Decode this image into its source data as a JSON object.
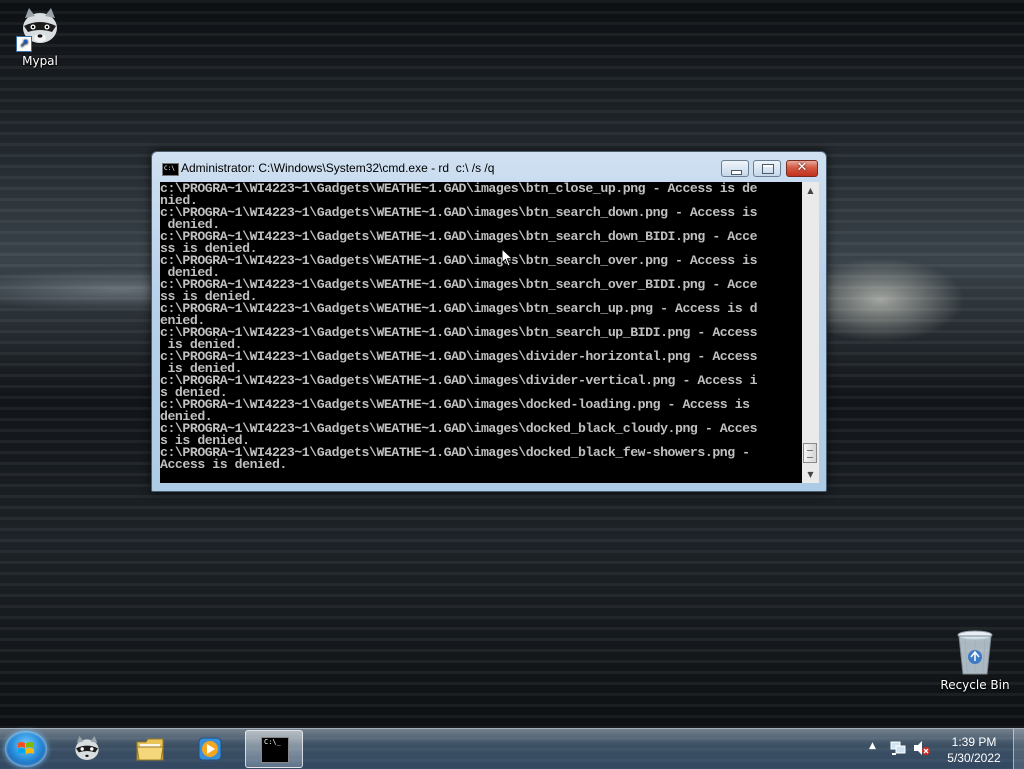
{
  "desktop": {
    "icons": [
      {
        "label": "Mypal",
        "icon": "raccoon-icon"
      },
      {
        "label": "Recycle Bin",
        "icon": "recycle-bin-icon"
      }
    ]
  },
  "cmd_window": {
    "icon_text": "C:\\",
    "title": "Administrator: C:\\Windows\\System32\\cmd.exe - rd  c:\\ /s /q",
    "minimize_glyph": "",
    "maximize_glyph": "",
    "close_glyph": "✕",
    "lines": [
      "c:\\PROGRA~1\\WI4223~1\\Gadgets\\WEATHE~1.GAD\\images\\btn_close_up.png - Access is de",
      "nied.",
      "c:\\PROGRA~1\\WI4223~1\\Gadgets\\WEATHE~1.GAD\\images\\btn_search_down.png - Access is",
      " denied.",
      "c:\\PROGRA~1\\WI4223~1\\Gadgets\\WEATHE~1.GAD\\images\\btn_search_down_BIDI.png - Acce",
      "ss is denied.",
      "c:\\PROGRA~1\\WI4223~1\\Gadgets\\WEATHE~1.GAD\\images\\btn_search_over.png - Access is",
      " denied.",
      "c:\\PROGRA~1\\WI4223~1\\Gadgets\\WEATHE~1.GAD\\images\\btn_search_over_BIDI.png - Acce",
      "ss is denied.",
      "c:\\PROGRA~1\\WI4223~1\\Gadgets\\WEATHE~1.GAD\\images\\btn_search_up.png - Access is d",
      "enied.",
      "c:\\PROGRA~1\\WI4223~1\\Gadgets\\WEATHE~1.GAD\\images\\btn_search_up_BIDI.png - Access",
      " is denied.",
      "c:\\PROGRA~1\\WI4223~1\\Gadgets\\WEATHE~1.GAD\\images\\divider-horizontal.png - Access",
      " is denied.",
      "c:\\PROGRA~1\\WI4223~1\\Gadgets\\WEATHE~1.GAD\\images\\divider-vertical.png - Access i",
      "s denied.",
      "c:\\PROGRA~1\\WI4223~1\\Gadgets\\WEATHE~1.GAD\\images\\docked-loading.png - Access is",
      "denied.",
      "c:\\PROGRA~1\\WI4223~1\\Gadgets\\WEATHE~1.GAD\\images\\docked_black_cloudy.png - Acces",
      "s is denied.",
      "c:\\PROGRA~1\\WI4223~1\\Gadgets\\WEATHE~1.GAD\\images\\docked_black_few-showers.png -",
      "Access is denied."
    ]
  },
  "taskbar": {
    "buttons": [
      {
        "name": "start",
        "icon": "windows-logo-icon"
      },
      {
        "name": "mypal",
        "icon": "raccoon-icon"
      },
      {
        "name": "explorer",
        "icon": "folder-icon"
      },
      {
        "name": "media-player",
        "icon": "media-player-icon"
      },
      {
        "name": "cmd",
        "icon": "command-prompt-icon",
        "active": true
      }
    ],
    "cmd_icon_text": "C:\\_",
    "tray": {
      "show_hidden_glyph": "▲",
      "icons": [
        "network-icon",
        "volume-muted-icon"
      ]
    },
    "clock": {
      "time": "1:39 PM",
      "date": "5/30/2022"
    }
  },
  "colors": {
    "console_bg": "#000000",
    "console_fg": "#c0c0c0",
    "title_bar": "#b9d1ea",
    "close_button": "#c0321d"
  }
}
